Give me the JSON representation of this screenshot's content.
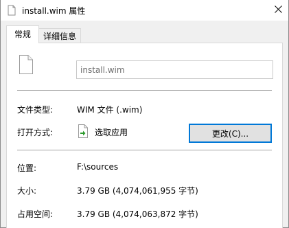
{
  "window": {
    "title": "install.wim 属性",
    "close_glyph": "✕"
  },
  "tabs": [
    {
      "label": "常规",
      "active": true
    },
    {
      "label": "详细信息",
      "active": false
    }
  ],
  "general": {
    "file_name": "install.wim",
    "file_type_label": "文件类型:",
    "file_type_value": "WIM 文件 (.wim)",
    "opens_with_label": "打开方式:",
    "opens_with_value": "选取应用",
    "change_button": "更改(C)...",
    "location_label": "位置:",
    "location_value": "F:\\sources",
    "size_label": "大小:",
    "size_value": "3.79 GB (4,074,061,955 字节)",
    "size_on_disk_label": "占用空间:",
    "size_on_disk_value": "3.79 GB (4,074,063,872 字节)"
  },
  "icons": {
    "title_icon": "file-icon",
    "file_icon": "file-icon",
    "opener_icon": "open-with-icon"
  }
}
